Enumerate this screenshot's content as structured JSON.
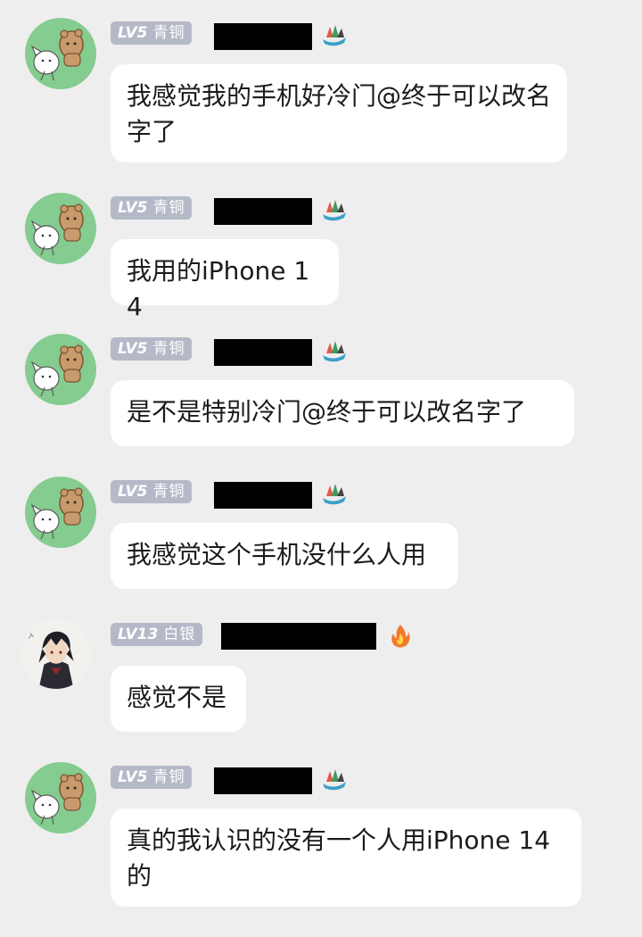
{
  "messages": [
    {
      "level": "LV5",
      "rank": "青铜",
      "text": "我感觉我的手机好冷门@终于可以改名字了",
      "tag_icon": "dragon-boat-icon",
      "avatar": "cartoon-animals-avatar"
    },
    {
      "level": "LV5",
      "rank": "青铜",
      "text": "我用的iPhone 14",
      "tag_icon": "dragon-boat-icon",
      "avatar": "cartoon-animals-avatar"
    },
    {
      "level": "LV5",
      "rank": "青铜",
      "text": "是不是特别冷门@终于可以改名字了",
      "tag_icon": "dragon-boat-icon",
      "avatar": "cartoon-animals-avatar"
    },
    {
      "level": "LV5",
      "rank": "青铜",
      "text": "我感觉这个手机没什么人用",
      "tag_icon": "dragon-boat-icon",
      "avatar": "cartoon-animals-avatar"
    },
    {
      "level": "LV13",
      "rank": "白银",
      "text": "感觉不是",
      "tag_icon": "fire-icon",
      "avatar": "anime-character-avatar"
    },
    {
      "level": "LV5",
      "rank": "青铜",
      "text": "真的我认识的没有一个人用iPhone 14的",
      "tag_icon": "dragon-boat-icon",
      "avatar": "cartoon-animals-avatar"
    }
  ],
  "colors": {
    "background": "#eeeeee",
    "bubble": "#ffffff",
    "badge": "#b5b9c7",
    "avatar_green": "#84cc8f",
    "text": "#1b1b1b"
  }
}
